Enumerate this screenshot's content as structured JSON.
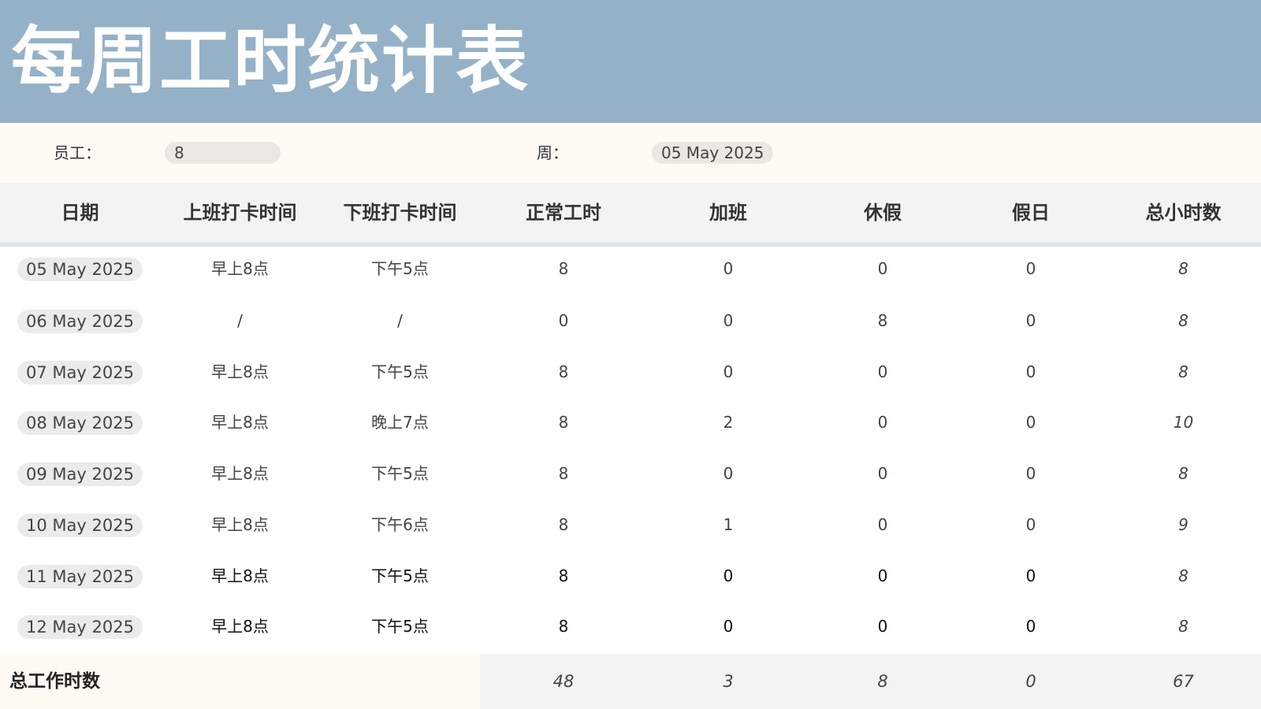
{
  "title": "每周工时统计表",
  "employee": {
    "label": "员工：",
    "value": "8"
  },
  "week": {
    "label": "周：",
    "value": "05 May 2025"
  },
  "columns": [
    "日期",
    "上班打卡时间",
    "下班打卡时间",
    "正常工时",
    "加班",
    "休假",
    "假日",
    "总小时数"
  ],
  "rows": [
    {
      "date": "05 May 2025",
      "clock_in": "早上8点",
      "clock_out": "下午5点",
      "regular": "8",
      "overtime": "0",
      "leave": "0",
      "holiday": "0",
      "total": "8"
    },
    {
      "date": "06 May 2025",
      "clock_in": "/",
      "clock_out": "/",
      "regular": "0",
      "overtime": "0",
      "leave": "8",
      "holiday": "0",
      "total": "8"
    },
    {
      "date": "07 May 2025",
      "clock_in": "早上8点",
      "clock_out": "下午5点",
      "regular": "8",
      "overtime": "0",
      "leave": "0",
      "holiday": "0",
      "total": "8"
    },
    {
      "date": "08 May 2025",
      "clock_in": "早上8点",
      "clock_out": "晚上7点",
      "regular": "8",
      "overtime": "2",
      "leave": "0",
      "holiday": "0",
      "total": "10"
    },
    {
      "date": "09 May 2025",
      "clock_in": "早上8点",
      "clock_out": "下午5点",
      "regular": "8",
      "overtime": "0",
      "leave": "0",
      "holiday": "0",
      "total": "8"
    },
    {
      "date": "10 May 2025",
      "clock_in": "早上8点",
      "clock_out": "下午6点",
      "regular": "8",
      "overtime": "1",
      "leave": "0",
      "holiday": "0",
      "total": "9"
    },
    {
      "date": "11 May 2025",
      "clock_in": "早上8点",
      "clock_out": "下午5点",
      "regular": "8",
      "overtime": "0",
      "leave": "0",
      "holiday": "0",
      "total": "8"
    },
    {
      "date": "12 May 2025",
      "clock_in": "早上8点",
      "clock_out": "下午5点",
      "regular": "8",
      "overtime": "0",
      "leave": "0",
      "holiday": "0",
      "total": "8"
    }
  ],
  "totals": {
    "label": "总工作时数",
    "regular": "48",
    "overtime": "3",
    "leave": "8",
    "holiday": "0",
    "total": "67"
  },
  "colors": {
    "header_bg": "#95b1c7",
    "info_bg": "#fffbf4",
    "table_header_bg": "#f3f3f3",
    "pill_bg": "#ebebeb"
  }
}
